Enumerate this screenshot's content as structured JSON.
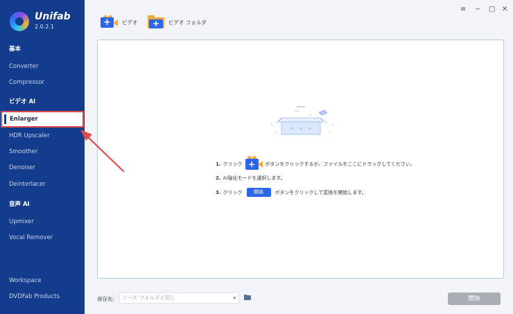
{
  "app": {
    "name": "Unifab",
    "version": "2.0.2.1"
  },
  "sidebar": {
    "sections": [
      {
        "label": "基本",
        "items": [
          "Converter",
          "Compressor"
        ]
      },
      {
        "label": "ビデオ AI",
        "items": [
          "Enlarger",
          "HDR Upscaler",
          "Smoother",
          "Denoiser",
          "Deinterlacer"
        ]
      },
      {
        "label": "音声 AI",
        "items": [
          "Upmixer",
          "Vocal Remover"
        ]
      }
    ],
    "active_item": "Enlarger",
    "footer": [
      "Workspace",
      "DVDFab Products"
    ]
  },
  "toolbar": {
    "add_video_label": "ビデオ",
    "add_folder_label": "ビデオ フォルダ"
  },
  "window_controls": {
    "menu": "≡",
    "minimize": "−",
    "maximize": "□",
    "close": "✕"
  },
  "drop_area": {
    "step1_num": "1.",
    "step1_pre": "クリック",
    "step1_post": "ボタンをクリックするか、ファイルをここにドラッグしてください。",
    "step2_num": "2.",
    "step2_text": "AI強化モードを選択します。",
    "step3_num": "3.",
    "step3_pre": "クリック",
    "step3_button": "開始",
    "step3_post": "ボタンをクリックして変換を開始します。"
  },
  "bottom": {
    "save_label": "保存先:",
    "save_placeholder": "ソース フォルダと同じ",
    "start_label": "開始"
  },
  "colors": {
    "sidebar_bg": "#143c8c",
    "accent": "#2a66e8",
    "annotation": "#e24a4a",
    "start_disabled": "#a9adb4"
  }
}
